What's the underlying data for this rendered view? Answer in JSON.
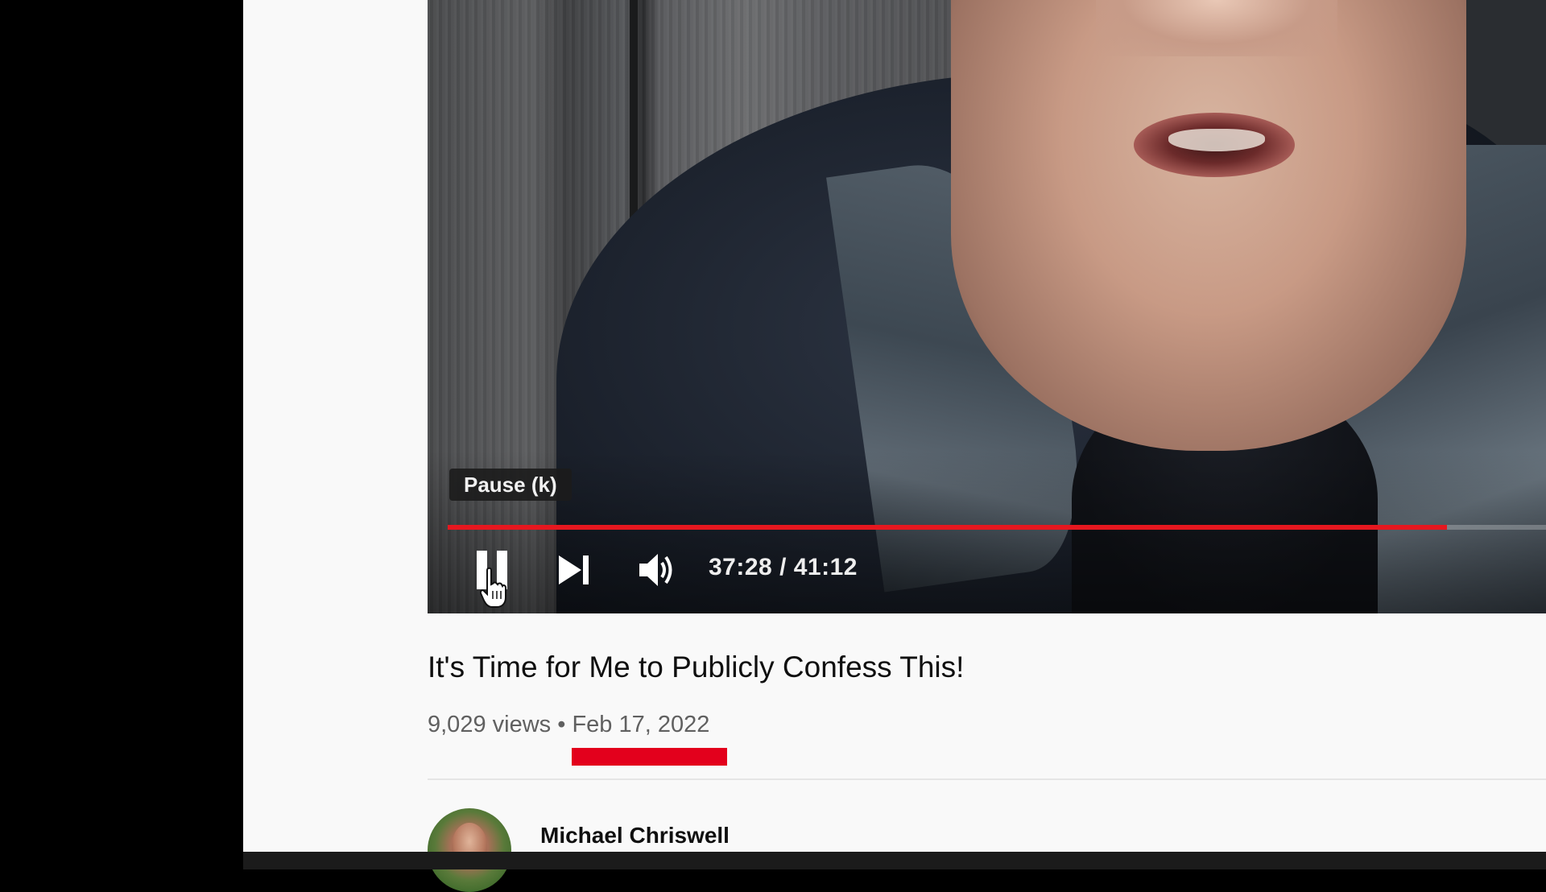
{
  "player": {
    "tooltip": "Pause (k)",
    "current_time": "37:28",
    "duration": "41:12",
    "time_display": "37:28 / 41:12",
    "progress_fraction": 0.91,
    "progress_color": "#e6171f",
    "controls": {
      "pause_icon": "pause-icon",
      "next_icon": "skip-next-icon",
      "volume_icon": "volume-icon",
      "cursor_icon": "hand-cursor-icon"
    }
  },
  "video": {
    "title": "It's Time for Me to Publicly Confess This!",
    "views": "9,029 views",
    "separator": "•",
    "date": "Feb 17, 2022",
    "highlight_color": "#e3001c"
  },
  "channel": {
    "name": "Michael Chriswell"
  }
}
